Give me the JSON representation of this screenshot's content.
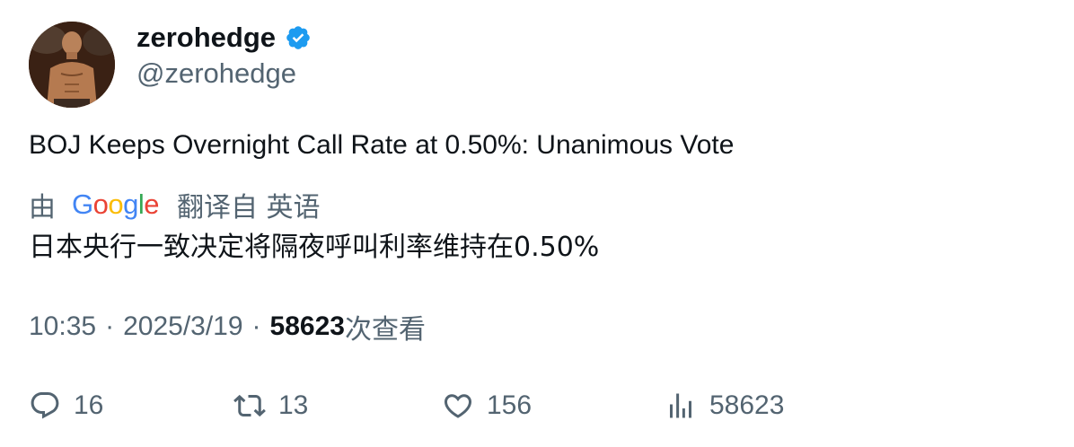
{
  "author": {
    "display_name": "zerohedge",
    "handle": "@zerohedge",
    "verified": true,
    "verified_color": "#1d9bf0"
  },
  "tweet": {
    "text": "BOJ Keeps Overnight Call Rate at 0.50%: Unanimous Vote"
  },
  "translation": {
    "prefix": "由",
    "provider": "Google",
    "suffix": "翻译自 英语",
    "text": "日本央行一致决定将隔夜呼叫利率维持在0.50%"
  },
  "meta": {
    "time": "10:35",
    "separator": "·",
    "date": "2025/3/19",
    "views_count": "58623",
    "views_label": "次查看"
  },
  "actions": {
    "replies": "16",
    "retweets": "13",
    "likes": "156",
    "views": "58623"
  },
  "icons": {
    "reply": "reply-icon",
    "retweet": "retweet-icon",
    "like": "heart-icon",
    "views": "analytics-icon",
    "verified": "verified-badge-icon"
  }
}
